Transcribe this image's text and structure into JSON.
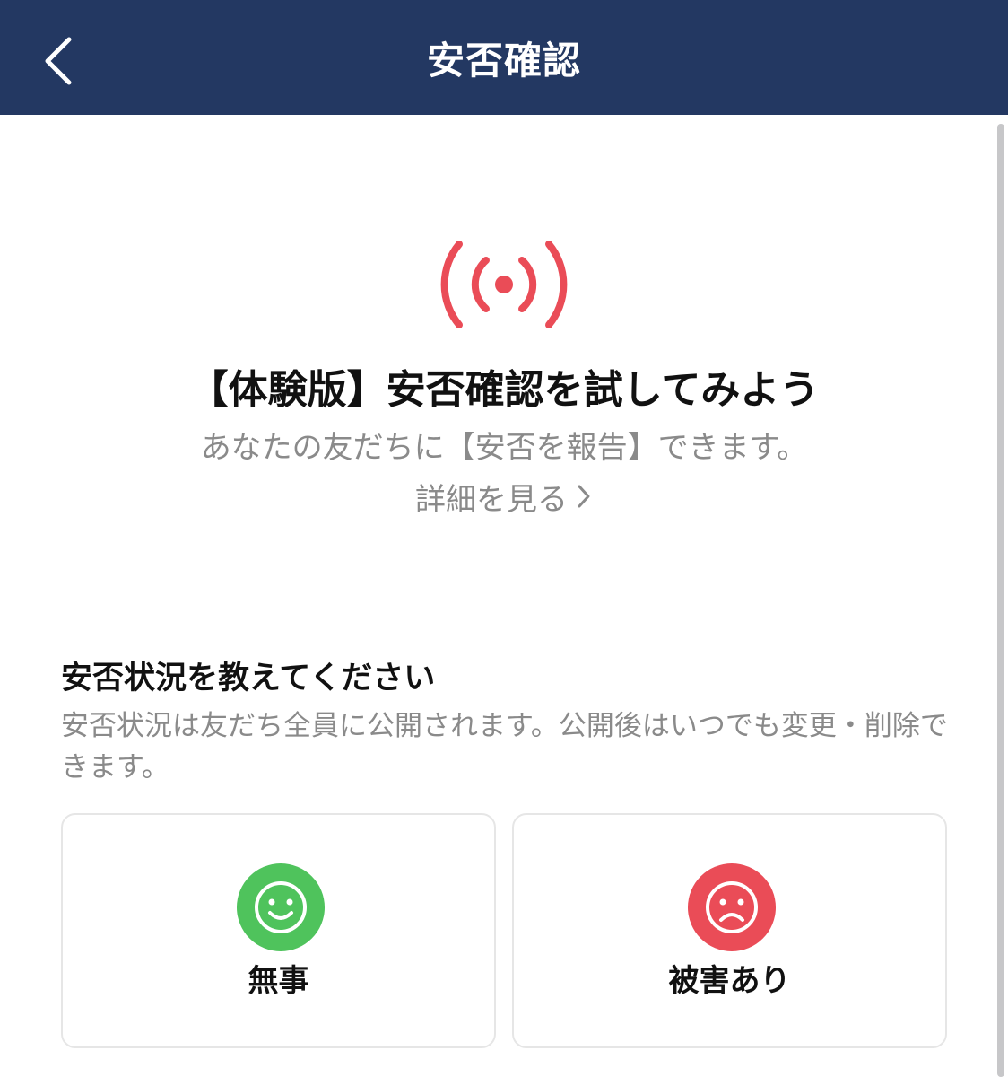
{
  "header": {
    "title": "安否確認",
    "back_icon": "chevron-left-icon"
  },
  "hero": {
    "icon": "broadcast-icon",
    "title": "【体験版】安否確認を試してみよう",
    "subtitle": "あなたの友だちに【安否を報告】できます。",
    "detail_link": "詳細を見る"
  },
  "status_section": {
    "title": "安否状況を教えてください",
    "description": "安否状況は友だち全員に公開されます。公開後はいつでも変更・削除できます。"
  },
  "options": [
    {
      "label": "無事",
      "icon": "smiley-face-icon",
      "color": "#4fc35c"
    },
    {
      "label": "被害あり",
      "icon": "sad-face-icon",
      "color": "#ea4c57"
    }
  ],
  "colors": {
    "header_bg": "#233862",
    "accent_red": "#ea4c57",
    "safe_green": "#4fc35c"
  }
}
